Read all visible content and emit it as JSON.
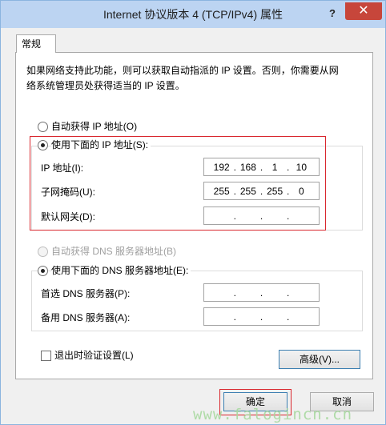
{
  "window": {
    "title": "Internet 协议版本 4 (TCP/IPv4) 属性",
    "help_label": "?",
    "close_label": "✕"
  },
  "tabs": [
    {
      "label": "常规"
    }
  ],
  "description_line1": "如果网络支持此功能，则可以获取自动指派的 IP 设置。否则，你需要从网",
  "description_line2": "络系统管理员处获得适当的 IP 设置。",
  "ip_section": {
    "auto_label": "自动获得 IP 地址(O)",
    "manual_label": "使用下面的 IP 地址(S):",
    "mode": "manual",
    "fields": [
      {
        "label": "IP 地址(I):",
        "octets": [
          "192",
          "168",
          "1",
          "10"
        ]
      },
      {
        "label": "子网掩码(U):",
        "octets": [
          "255",
          "255",
          "255",
          "0"
        ]
      },
      {
        "label": "默认网关(D):",
        "octets": [
          "",
          "",
          "",
          ""
        ]
      }
    ]
  },
  "dns_section": {
    "auto_label": "自动获得 DNS 服务器地址(B)",
    "manual_label": "使用下面的 DNS 服务器地址(E):",
    "mode": "manual",
    "fields": [
      {
        "label": "首选 DNS 服务器(P):",
        "octets": [
          "",
          "",
          "",
          ""
        ]
      },
      {
        "label": "备用 DNS 服务器(A):",
        "octets": [
          "",
          "",
          "",
          ""
        ]
      }
    ]
  },
  "validate_on_exit": {
    "label": "退出时验证设置(L)",
    "checked": false
  },
  "buttons": {
    "advanced": "高级(V)...",
    "ok": "确定",
    "cancel": "取消"
  },
  "watermark": "www.falogincn.cn",
  "colors": {
    "titlebar": "#bcd4f2",
    "close_button": "#c7463b",
    "highlight": "#d9272e"
  }
}
